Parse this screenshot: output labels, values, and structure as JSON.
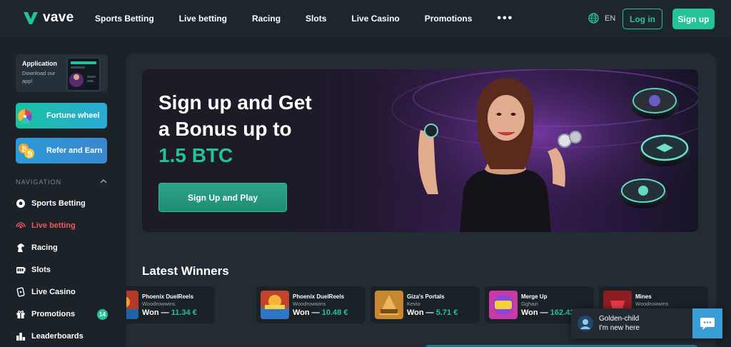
{
  "header": {
    "logo_text": "vave",
    "nav": [
      "Sports Betting",
      "Live betting",
      "Racing",
      "Slots",
      "Live Casino",
      "Promotions"
    ],
    "more_label": "•••",
    "language": "EN",
    "login_label": "Log in",
    "signup_label": "Sign up"
  },
  "sidebar": {
    "app_card": {
      "title": "Application",
      "subtitle": "Download our app!"
    },
    "promos": [
      {
        "label": "Fortune wheel",
        "icon": "fortune-wheel-icon"
      },
      {
        "label": "Refer and Earn",
        "icon": "coins-icon"
      }
    ],
    "navigation_heading": "NAVIGATION",
    "items": [
      {
        "label": "Sports Betting",
        "icon": "soccer-ball-icon"
      },
      {
        "label": "Live betting",
        "icon": "live-broadcast-icon",
        "active": true
      },
      {
        "label": "Racing",
        "icon": "horse-icon"
      },
      {
        "label": "Slots",
        "icon": "slot-machine-icon"
      },
      {
        "label": "Live Casino",
        "icon": "casino-chip-icon"
      },
      {
        "label": "Promotions",
        "icon": "gift-icon",
        "badge": "14"
      },
      {
        "label": "Leaderboards",
        "icon": "trophy-icon"
      }
    ]
  },
  "hero": {
    "title_line1": "Sign up and Get",
    "title_line2": "a Bonus up to",
    "title_accent": "1.5 BTC",
    "cta_label": "Sign Up and Play"
  },
  "winners": {
    "title": "Latest Winners",
    "won_prefix": "Won —",
    "items": [
      {
        "game": "Phoenix DuelReels",
        "user": "Woodrowwins",
        "amount": "11.34 €"
      },
      {
        "game": "Phoenix DuelReels",
        "user": "Woodrowwins",
        "amount": "10.48 €"
      },
      {
        "game": "Giza's Portals",
        "user": "Kevio",
        "amount": "5.71 €"
      },
      {
        "game": "Merge Up",
        "user": "Gghazi",
        "amount": "162.42"
      },
      {
        "game": "Mines",
        "user": "Woodrowwins",
        "amount": ""
      }
    ]
  },
  "chat": {
    "name": "Golden-child",
    "message": "I'm new here"
  },
  "colors": {
    "accent": "#24c397",
    "live": "#f25858",
    "background": "#1b2228"
  }
}
